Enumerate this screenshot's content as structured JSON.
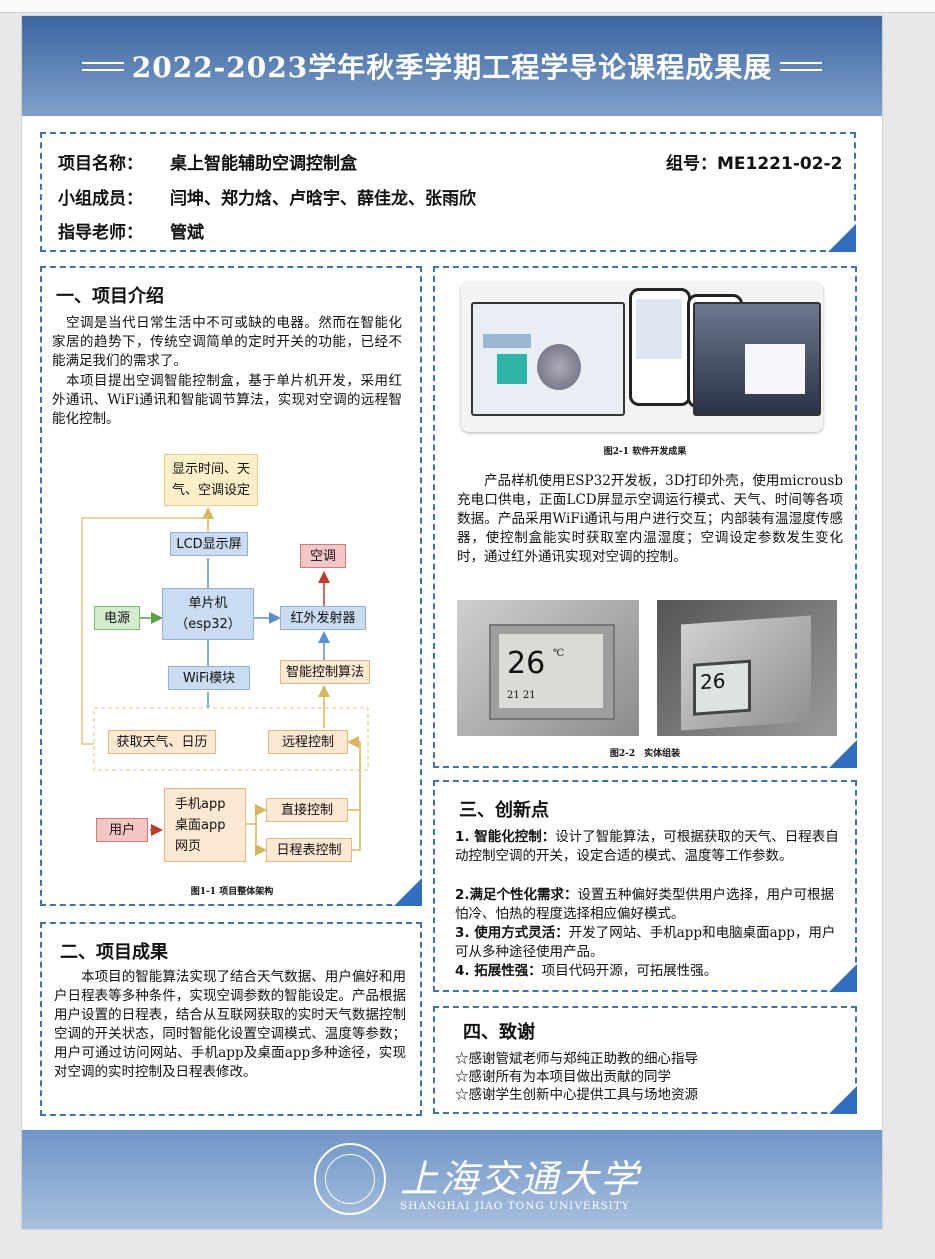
{
  "poster": {
    "title": "2022-2023学年秋季学期工程学导论课程成果展",
    "info": {
      "project_name_key": "项目名称：",
      "project_name": "桌上智能辅助空调控制盒",
      "group_key": "组号：",
      "group": "ME1221-02-2",
      "members_key": "小组成员：",
      "members": "闫坤、郑力焓、卢晗宇、薛佳龙、张雨欣",
      "advisor_key": "指导老师：",
      "advisor": "管斌"
    },
    "intro": {
      "heading": "一、项目介绍",
      "text": "　空调是当代日常生活中不可或缺的电器。然而在智能化家居的趋势下，传统空调简单的定时开关的功能，已经不能满足我们的需求了。　本项目提出空调智能控制盒，基于单片机开发，采用红外通讯、WiFi通讯和智能调节算法，实现对空调的远程智能化控制。",
      "p1": "　空调是当代日常生活中不可或缺的电器。然而在智能化家居的趋势下，传统空调简单的定时开关的功能，已经不能满足我们的需求了。",
      "p2": "　本项目提出空调智能控制盒，基于单片机开发，采用红外通讯、WiFi通讯和智能调节算法，实现对空调的远程智能化控制。",
      "figure_caption": "图1-1 项目整体架构",
      "diagram": {
        "display": "显示时间、天气、空调设定",
        "lcd": "LCD显示屏",
        "ac": "空调",
        "power": "电源",
        "mcu": "单片机\n（esp32）",
        "mcu_line1": "单片机",
        "mcu_line2": "（esp32）",
        "ir": "红外发射器",
        "wifi": "WiFi模块",
        "algo": "智能控制算法",
        "weather": "获取天气、日历",
        "remote": "远程控制",
        "user": "用户",
        "apps_line1": "手机app",
        "apps_line2": "桌面app",
        "apps_line3": "网页",
        "direct": "直接控制",
        "schedule": "日程表控制"
      }
    },
    "software": {
      "figure_caption": "图2-1 软件开发成果",
      "text": "　　产品样机使用ESP32开发板，3D打印外壳，使用microusb充电口供电，正面LCD屏显示空调运行模式、天气、时间等各项数据。产品采用WiFi通讯与用户进行交互；内部装有温湿度传感器，使控制盒能实时获取室内温湿度；空调设定参数发生变化时，通过红外通讯实现对空调的控制。",
      "photo_caption": "图2-2　实体组装",
      "screen_temp": "26",
      "screen_unit": "℃",
      "screen_time": "21 21"
    },
    "results": {
      "heading": "二、项目成果",
      "text": "　　本项目的智能算法实现了结合天气数据、用户偏好和用户日程表等多种条件，实现空调参数的智能设定。产品根据用户设置的日程表，结合从互联网获取的实时天气数据控制空调的开关状态，同时智能化设置空调模式、温度等参数；用户可通过访问网站、手机app及桌面app多种途径，实现对空调的实时控制及日程表修改。"
    },
    "innovation": {
      "heading": "三、创新点",
      "items": [
        {
          "label": "1. 智能化控制：",
          "text": "设计了智能算法，可根据获取的天气、日程表自动控制空调的开关，设定合适的模式、温度等工作参数。"
        },
        {
          "label": "2.满足个性化需求：",
          "text": "设置五种偏好类型供用户选择，用户可根据怕冷、怕热的程度选择相应偏好模式。"
        },
        {
          "label": "3. 使用方式灵活：",
          "text": "开发了网站、手机app和电脑桌面app，用户可从多种途径使用产品。"
        },
        {
          "label": "4. 拓展性强：",
          "text": "项目代码开源，可拓展性强。"
        }
      ]
    },
    "thanks": {
      "heading": "四、致谢",
      "items": [
        "☆感谢管斌老师与郑纯正助教的细心指导",
        "☆感谢所有为本项目做出贡献的同学",
        "☆感谢学生创新中心提供工具与场地资源"
      ]
    },
    "footer": {
      "university_cn": "上海交通大学",
      "university_en": "SHANGHAI JIAO TONG UNIVERSITY"
    }
  },
  "colors": {
    "accent": "#3b72b8",
    "banner": "#4f77ad"
  }
}
